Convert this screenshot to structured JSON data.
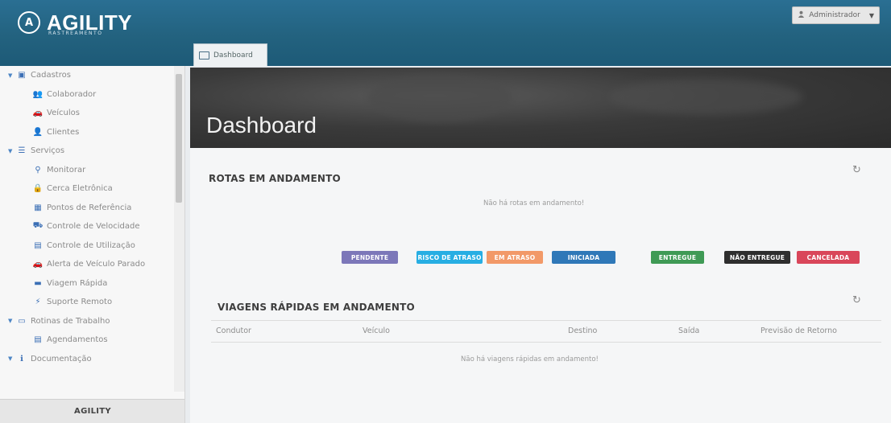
{
  "app": {
    "logo_text": "AGILITY",
    "logo_sub": "RASTREAMENTO"
  },
  "header": {
    "user_label": "Administrador"
  },
  "tab": {
    "label": "Dashboard"
  },
  "sidebar": {
    "items": [
      {
        "label": "Cadastros",
        "level": 0,
        "icon": "table-icon"
      },
      {
        "label": "Colaborador",
        "level": 1,
        "icon": "user-group-icon"
      },
      {
        "label": "Veículos",
        "level": 1,
        "icon": "car-icon"
      },
      {
        "label": "Clientes",
        "level": 1,
        "icon": "users-icon"
      },
      {
        "label": "Serviços",
        "level": 0,
        "icon": "list-icon"
      },
      {
        "label": "Monitorar",
        "level": 1,
        "icon": "map-marker-icon"
      },
      {
        "label": "Cerca Eletrônica",
        "level": 1,
        "icon": "lock-icon"
      },
      {
        "label": "Pontos de Referência",
        "level": 1,
        "icon": "building-icon"
      },
      {
        "label": "Controle de Velocidade",
        "level": 1,
        "icon": "road-icon"
      },
      {
        "label": "Controle de Utilização",
        "level": 1,
        "icon": "calendar-icon"
      },
      {
        "label": "Alerta de Veículo Parado",
        "level": 1,
        "icon": "car-icon"
      },
      {
        "label": "Viagem Rápida",
        "level": 1,
        "icon": "briefcase-icon"
      },
      {
        "label": "Suporte Remoto",
        "level": 1,
        "icon": "signal-icon"
      },
      {
        "label": "Rotinas de Trabalho",
        "level": 0,
        "icon": "folder-icon"
      },
      {
        "label": "Agendamentos",
        "level": 1,
        "icon": "calendar-icon"
      },
      {
        "label": "Documentação",
        "level": 0,
        "icon": "info-icon"
      }
    ],
    "footer": "AGILITY"
  },
  "page": {
    "title": "Dashboard"
  },
  "rotas": {
    "title": "ROTAS EM ANDAMENTO",
    "empty": "Não há rotas em andamento!",
    "legend": [
      {
        "label": "PENDENTE",
        "color": "#7c77b9"
      },
      {
        "label": "RISCO DE ATRASO",
        "color": "#27aee3"
      },
      {
        "label": "EM ATRASO",
        "color": "#f29968"
      },
      {
        "label": "INICIADA",
        "color": "#2f78b8"
      },
      {
        "label": "ENTREGUE",
        "color": "#3f9a55"
      },
      {
        "label": "NÃO ENTREGUE",
        "color": "#2e2e2e"
      },
      {
        "label": "CANCELADA",
        "color": "#d9465a"
      }
    ]
  },
  "viagens": {
    "title": "VIAGENS RÁPIDAS EM ANDAMENTO",
    "columns": [
      "Condutor",
      "Veículo",
      "Destino",
      "Saída",
      "Previsão de Retorno"
    ],
    "empty": "Não há viagens rápidas em andamento!"
  }
}
